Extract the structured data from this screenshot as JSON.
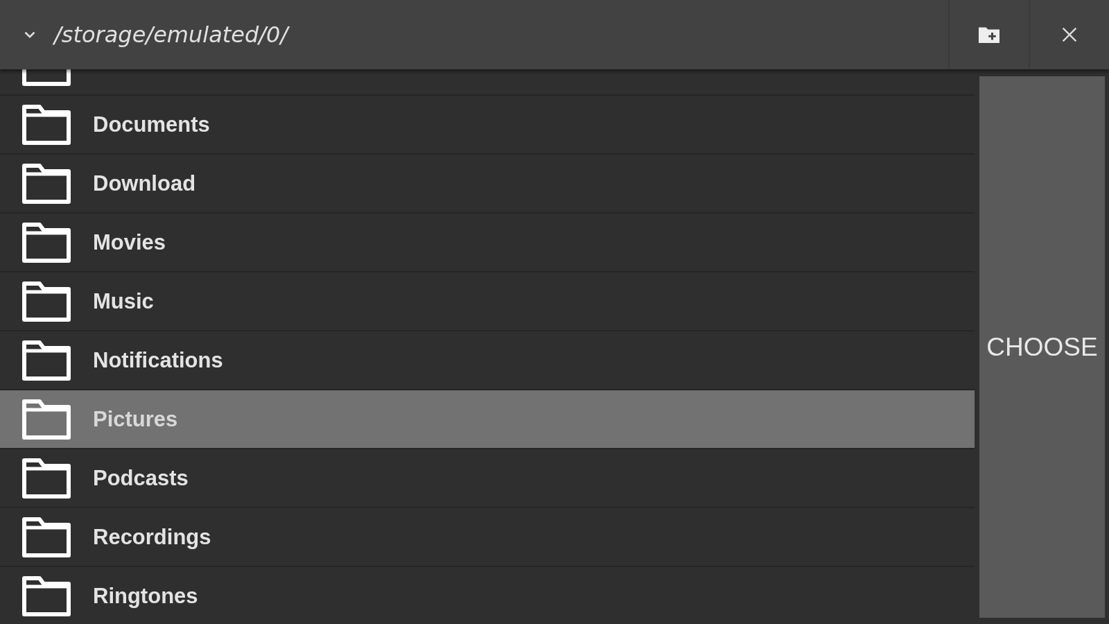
{
  "header": {
    "path": "/storage/emulated/0/"
  },
  "folders": [
    {
      "selected": false
    },
    {
      "name": "Documents",
      "selected": false
    },
    {
      "name": "Download",
      "selected": false
    },
    {
      "name": "Movies",
      "selected": false
    },
    {
      "name": "Music",
      "selected": false
    },
    {
      "name": "Notifications",
      "selected": false
    },
    {
      "name": "Pictures",
      "selected": true
    },
    {
      "name": "Podcasts",
      "selected": false
    },
    {
      "name": "Recordings",
      "selected": false
    },
    {
      "name": "Ringtones",
      "selected": false
    }
  ],
  "choose_button": {
    "label": "CHOOSE"
  }
}
